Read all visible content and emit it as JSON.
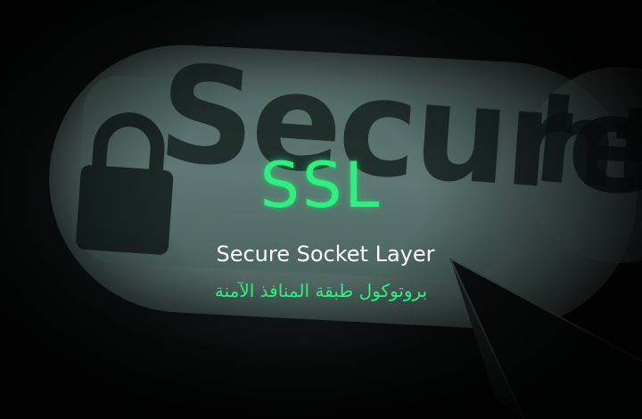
{
  "background": {
    "address_word": "Secure",
    "protocol_fragment": "htt",
    "lock_icon": "lock-icon",
    "cursor_icon": "cursor-arrow-icon"
  },
  "headline": {
    "title": "SSL",
    "subtitle": "Secure Socket Layer",
    "arabic": "بروتوكول طبقة المنافذ الآمنة"
  },
  "colors": {
    "accent_green": "#2ef07e",
    "text_white": "#ffffff",
    "background_teal": "#5f7572"
  }
}
